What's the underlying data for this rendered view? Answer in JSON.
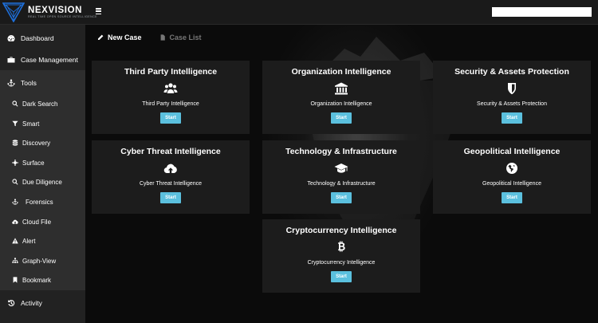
{
  "header": {
    "logo_title": "NEXVISION",
    "logo_subtitle": "REAL TIME OPEN SOURCE INTELLIGENCE",
    "search_value": ""
  },
  "sidebar": {
    "dashboard": "Dashboard",
    "case_management": "Case Management",
    "tools": "Tools",
    "tool_items": [
      {
        "label": "Dark Search",
        "icon": "search-icon"
      },
      {
        "label": "Smart",
        "icon": "filter-icon"
      },
      {
        "label": "Discovery",
        "icon": "database-icon"
      },
      {
        "label": "Surface",
        "icon": "crosshair-icon"
      },
      {
        "label": "Due Diligence",
        "icon": "search-icon"
      },
      {
        "label": "Forensics",
        "icon": "anchor-icon"
      },
      {
        "label": "Cloud File",
        "icon": "cloud-upload-icon"
      },
      {
        "label": "Alert",
        "icon": "warning-icon"
      },
      {
        "label": "Graph-View",
        "icon": "sitemap-icon"
      },
      {
        "label": "Bookmark",
        "icon": "bookmark-icon"
      }
    ],
    "activity": "Activity"
  },
  "tabs": {
    "new_case": "New Case",
    "case_list": "Case List"
  },
  "cards": [
    {
      "title": "Third Party Intelligence",
      "subtitle": "Third Party Intelligence",
      "icon": "users-icon",
      "button": "Start"
    },
    {
      "title": "Organization Intelligence",
      "subtitle": "Organization Intelligence",
      "icon": "bank-icon",
      "button": "Start"
    },
    {
      "title": "Security & Assets Protection",
      "subtitle": "Security & Assets Protection",
      "icon": "shield-icon",
      "button": "Start"
    },
    {
      "title": "Cyber Threat Intelligence",
      "subtitle": "Cyber Threat Intelligence",
      "icon": "cloud-upload-icon",
      "button": "Start"
    },
    {
      "title": "Technology & Infrastructure",
      "subtitle": "Technology & Infrastructure",
      "icon": "graduation-cap-icon",
      "button": "Start"
    },
    {
      "title": "Geopolitical Intelligence",
      "subtitle": "Geopolitical Intelligence",
      "icon": "globe-icon",
      "button": "Start"
    },
    {
      "title": "Cryptocurrency Intelligence",
      "subtitle": "Cryptocurrency Intelligence",
      "icon": "bitcoin-icon",
      "button": "Start"
    }
  ],
  "colors": {
    "accent_button": "#5bc0de",
    "card_bg": "#1c1c1c",
    "sidebar_bg": "#222222",
    "logo_blue": "#1e6fd9"
  }
}
